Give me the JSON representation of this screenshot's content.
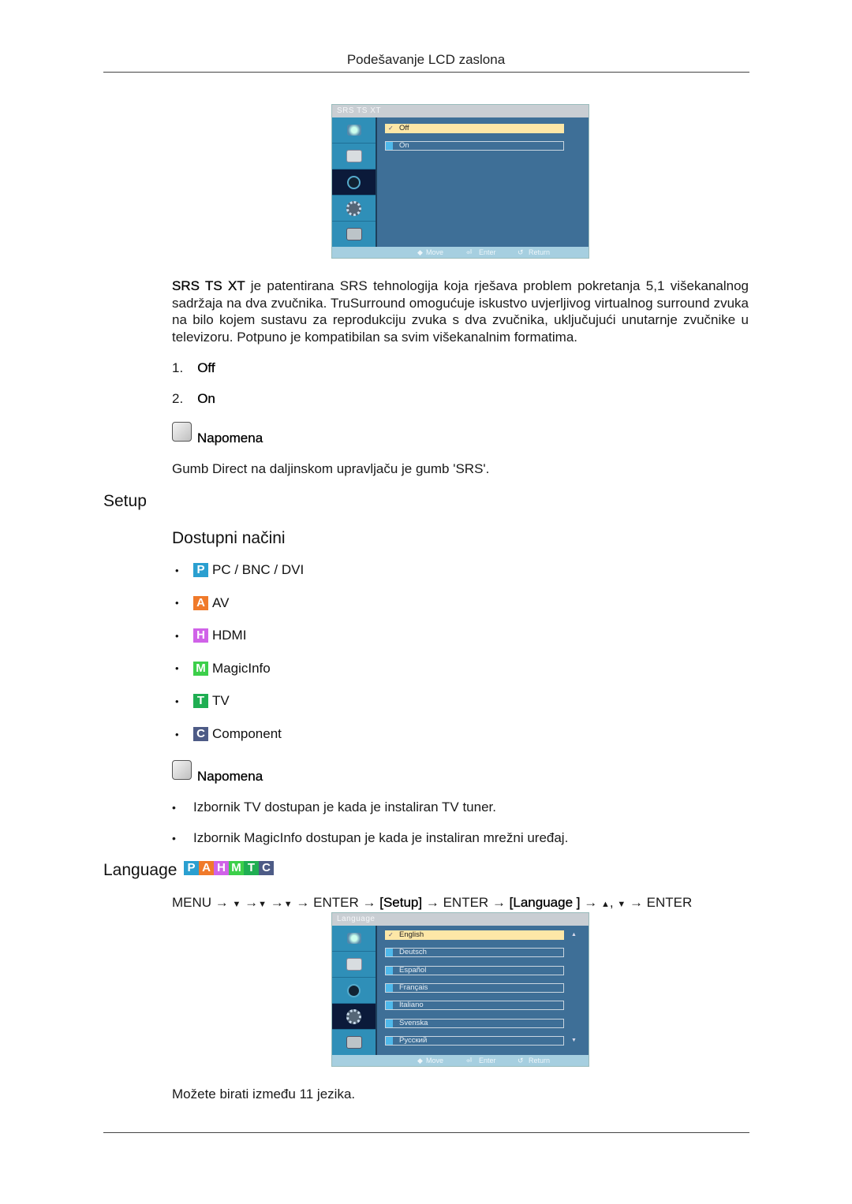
{
  "header": {
    "title": "Podešavanje LCD zaslona"
  },
  "osd_srs": {
    "title": "SRS TS XT",
    "options": [
      {
        "label": "Off",
        "selected": true
      },
      {
        "label": "On",
        "selected": false
      }
    ],
    "sidebar_icons": [
      "picture-icon",
      "screen-icon",
      "sound-icon",
      "setup-gear-icon",
      "multi-control-icon"
    ],
    "active_sidebar_index": 2,
    "footer": {
      "move": "Move",
      "enter": "Enter",
      "return": "Return"
    }
  },
  "srs_section": {
    "term": "SRS TS XT",
    "description": " je patentirana SRS tehnologija koja rješava problem pokretanja 5,1 višekanalnog sadržaja na dva zvučnika. TruSurround omogućuje iskustvo uvjerljivog virtualnog surround zvuka na bilo kojem sustavu za reprodukciju zvuka s dva zvučnika, uključujući unutarnje zvučnike u televizoru. Potpuno je kompatibilan sa svim višekanalnim formatima.",
    "list": [
      {
        "num": "1.",
        "label": "Off"
      },
      {
        "num": "2.",
        "label": "On"
      }
    ],
    "note_label": "Napomena",
    "note_text": "Gumb Direct na daljinskom upravljaču je gumb 'SRS'."
  },
  "setup_section": {
    "heading": "Setup",
    "subheading": "Dostupni načini",
    "modes": [
      {
        "letter": "P",
        "label": "PC / BNC / DVI",
        "color": "#2a9fd0"
      },
      {
        "letter": "A",
        "label": "AV",
        "color": "#f07a2a"
      },
      {
        "letter": "H",
        "label": "HDMI",
        "color": "#d062e8"
      },
      {
        "letter": "M",
        "label": "MagicInfo",
        "color": "#3ccf4a"
      },
      {
        "letter": "T",
        "label": "TV",
        "color": "#1fae52"
      },
      {
        "letter": "C",
        "label": "Component",
        "color": "#4d5b86"
      }
    ],
    "note_label": "Napomena",
    "notes": [
      "Izbornik TV dostupan je kada je instaliran TV tuner.",
      "Izbornik MagicInfo dostupan je kada je instaliran mrežni uređaj."
    ]
  },
  "language_section": {
    "heading": "Language",
    "mode_badges": [
      "P",
      "A",
      "H",
      "M",
      "T",
      "C"
    ],
    "nav": {
      "menu": "MENU",
      "arrow": "→",
      "down": "▼",
      "up": "▲",
      "enter": "ENTER",
      "setup": "[Setup]",
      "language": "[Language ]",
      "comma": ","
    },
    "osd": {
      "title": "Language",
      "options": [
        {
          "label": "English",
          "selected": true
        },
        {
          "label": "Deutsch",
          "selected": false
        },
        {
          "label": "Español",
          "selected": false
        },
        {
          "label": "Français",
          "selected": false
        },
        {
          "label": "Italiano",
          "selected": false
        },
        {
          "label": "Svenska",
          "selected": false
        },
        {
          "label": "Русский",
          "selected": false
        }
      ],
      "active_sidebar_index": 3,
      "footer": {
        "move": "Move",
        "enter": "Enter",
        "return": "Return"
      }
    },
    "footnote": "Možete birati između 11 jezika."
  }
}
